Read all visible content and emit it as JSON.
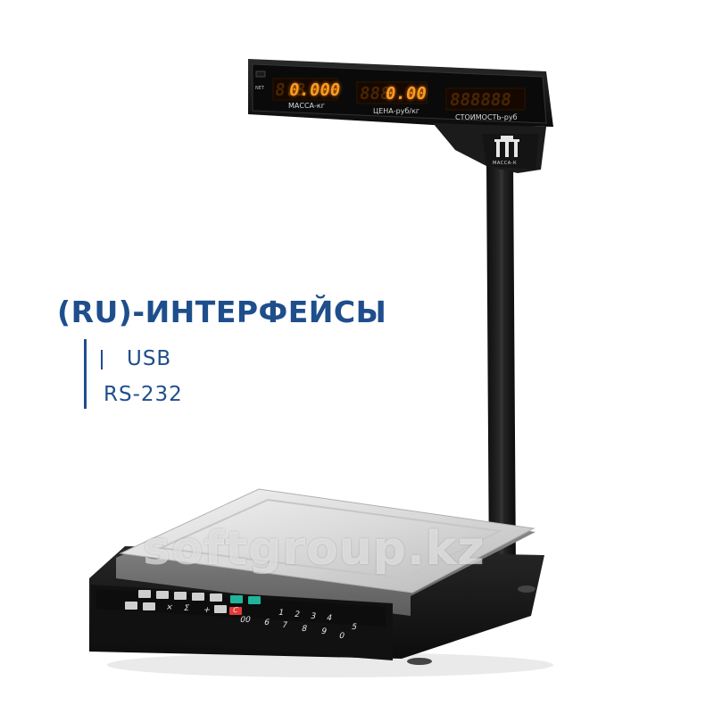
{
  "headline": "(RU)-ИНТЕРФЕЙСЫ",
  "interfaces": [
    "USB",
    "RS-232"
  ],
  "watermark": "softgroup.kz",
  "display": {
    "net_label": "NET",
    "panels": [
      {
        "label": "МАССА-кг",
        "ghost": "8.8",
        "value": "0.000"
      },
      {
        "label": "ЦЕНА-руб/кг",
        "ghost": "888",
        "value": "0.00"
      },
      {
        "label": "СТОИМОСТЬ-руб",
        "ghost": "888888",
        "value": ""
      }
    ],
    "brand": "МАССА-К"
  },
  "keypad": {
    "digits_row1": [
      "1",
      "2",
      "3",
      "4",
      "5"
    ],
    "digits_row2": [
      "6",
      "7",
      "8",
      "9",
      "0"
    ],
    "symbols": [
      "×",
      "Σ",
      "+"
    ],
    "special_keys": [
      "C",
      "00"
    ]
  },
  "colors": {
    "text_blue": "#1f4e8c",
    "display_orange": "#ff9a1f",
    "body_black": "#1a1a1a",
    "platform_steel": "#d6d6d6",
    "key_red": "#e53935",
    "key_green": "#1fb59a"
  }
}
